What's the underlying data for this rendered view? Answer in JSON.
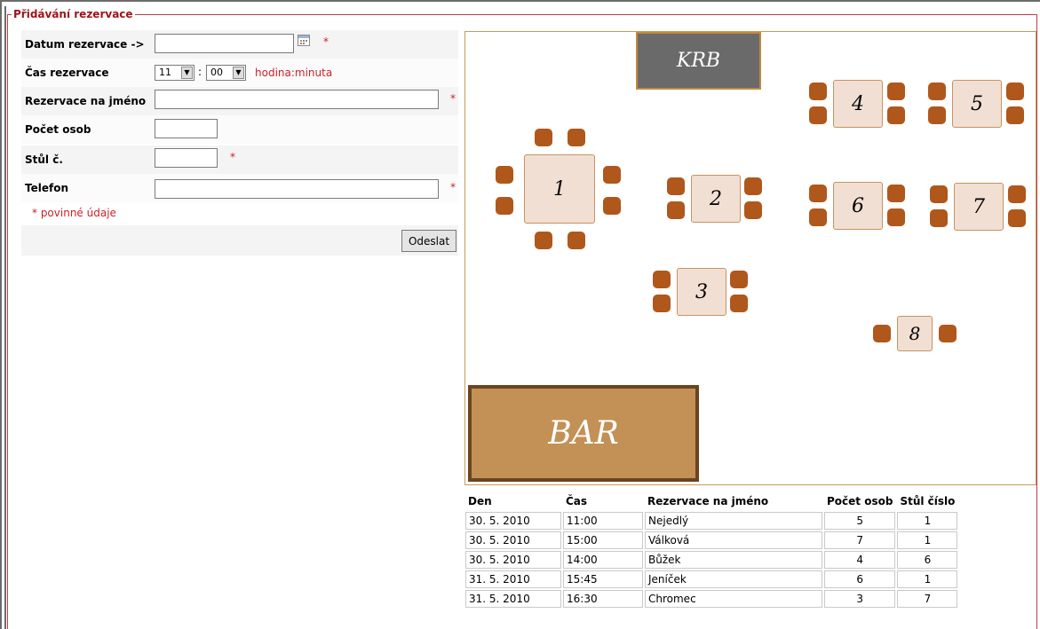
{
  "legend": "Přidávání rezervace",
  "form": {
    "date_label": "Datum rezervace ->",
    "date_value": "",
    "time_label": "Čas rezervace",
    "hour_value": "11",
    "minute_value": "00",
    "time_separator": ":",
    "time_hint": "hodina:minuta",
    "name_label": "Rezervace na jméno",
    "name_value": "",
    "persons_label": "Počet osob",
    "persons_value": "",
    "table_label": "Stůl č.",
    "table_value": "",
    "phone_label": "Telefon",
    "phone_value": "",
    "required_marker": "*",
    "required_note": "* povinné údaje",
    "submit_label": "Odeslat"
  },
  "floor_plan": {
    "fireplace_label": "KRB",
    "bar_label": "BAR",
    "tables": [
      "1",
      "2",
      "3",
      "4",
      "5",
      "6",
      "7",
      "8"
    ]
  },
  "reservations": {
    "headers": [
      "Den",
      "Čas",
      "Rezervace na jméno",
      "Počet osob",
      "Stůl číslo"
    ],
    "rows": [
      [
        "30. 5. 2010",
        "11:00",
        "Nejedlý",
        "5",
        "1"
      ],
      [
        "30. 5. 2010",
        "15:00",
        "Válková",
        "7",
        "1"
      ],
      [
        "30. 5. 2010",
        "14:00",
        "Bůžek",
        "4",
        "6"
      ],
      [
        "31. 5. 2010",
        "15:45",
        "Jeníček",
        "6",
        "1"
      ],
      [
        "31. 5. 2010",
        "16:30",
        "Chromec",
        "3",
        "7"
      ]
    ]
  },
  "colors": {
    "accent": "#a1131b",
    "required": "#cf2128",
    "chair": "#b0571b",
    "table_fill": "#f1dfd3",
    "fireplace": "#6a6a6a",
    "bar": "#c39055"
  }
}
